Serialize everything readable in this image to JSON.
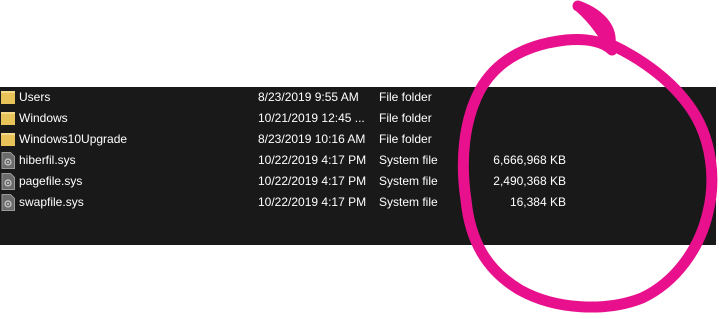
{
  "files": [
    {
      "name": "Users",
      "date": "8/23/2019 9:55 AM",
      "type": "File folder",
      "size": "",
      "icon": "folder-icon"
    },
    {
      "name": "Windows",
      "date": "10/21/2019 12:45 ...",
      "type": "File folder",
      "size": "",
      "icon": "folder-icon"
    },
    {
      "name": "Windows10Upgrade",
      "date": "8/23/2019 10:16 AM",
      "type": "File folder",
      "size": "",
      "icon": "folder-icon"
    },
    {
      "name": "hiberfil.sys",
      "date": "10/22/2019 4:17 PM",
      "type": "System file",
      "size": "6,666,968 KB",
      "icon": "system-file-icon"
    },
    {
      "name": "pagefile.sys",
      "date": "10/22/2019 4:17 PM",
      "type": "System file",
      "size": "2,490,368 KB",
      "icon": "system-file-icon"
    },
    {
      "name": "swapfile.sys",
      "date": "10/22/2019 4:17 PM",
      "type": "System file",
      "size": "16,384 KB",
      "icon": "system-file-icon"
    }
  ],
  "colors": {
    "pane_background": "#191919",
    "text": "#ffffff",
    "folder": "#e8c35a",
    "annotation": "#e8108c"
  }
}
